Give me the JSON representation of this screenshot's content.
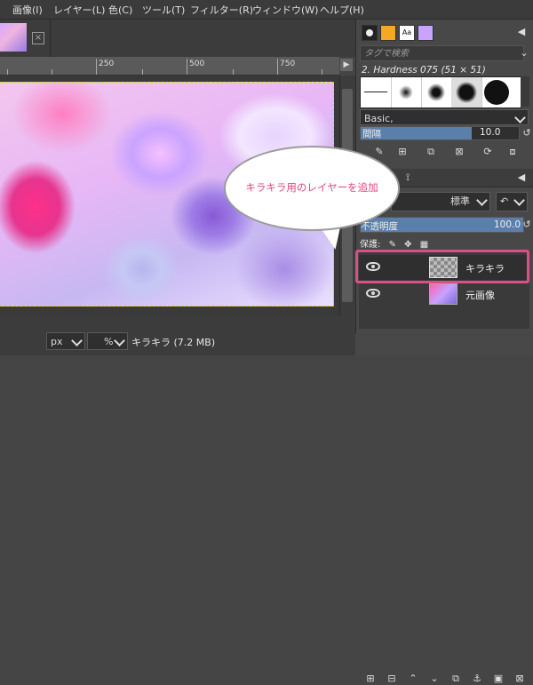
{
  "menu": [
    "画像(I)",
    "レイヤー(L)",
    "色(C)",
    "ツール(T)",
    "フィルター(R)",
    "ウィンドウ(W)",
    "ヘルプ(H)"
  ],
  "ruler": {
    "ticks": [
      "250",
      "500",
      "750"
    ]
  },
  "status": {
    "unit": "px",
    "zoom_suffix": "%",
    "text": "キラキラ (7.2 MB)"
  },
  "brushes": {
    "tag_placeholder": "タグで検索",
    "selected": "2. Hardness 075 (51 × 51)",
    "preset": "Basic,",
    "spacing_label": "間隔",
    "spacing_value": "10.0"
  },
  "layers": {
    "mode": "標準",
    "opacity_label": "不透明度",
    "opacity_value": "100.0",
    "lock_label": "保護:",
    "items": [
      {
        "name": "キラキラ",
        "visible": true
      },
      {
        "name": "元画像",
        "visible": true
      }
    ]
  },
  "callout": {
    "text": "キラキラ用のレイヤーを追加"
  },
  "colors": {
    "highlight": "#d94f87",
    "callout_text": "#e8407e"
  }
}
